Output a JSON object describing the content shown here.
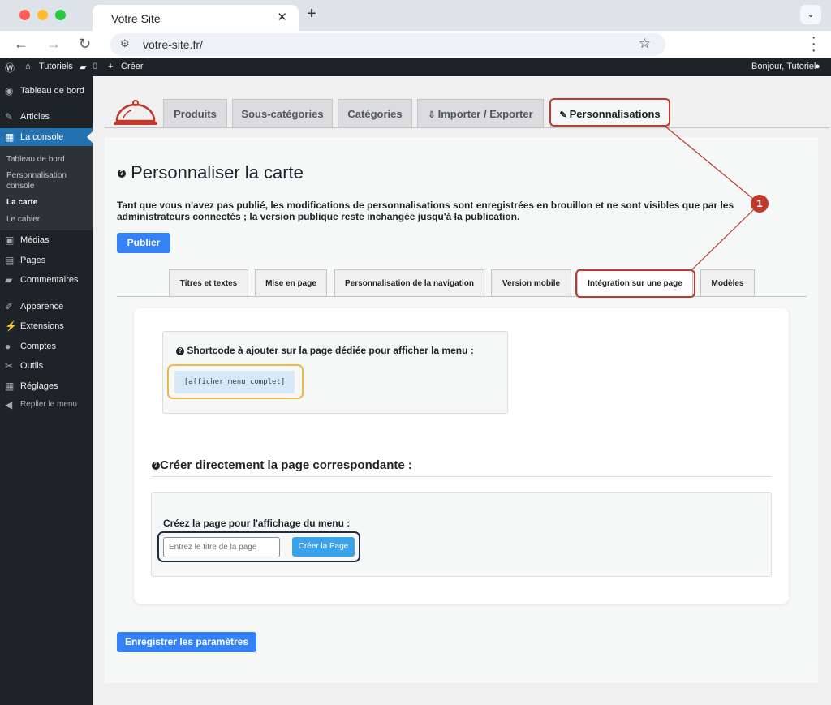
{
  "browser": {
    "tab_title": "Votre Site",
    "close": "✕",
    "new_tab": "+",
    "url": "votre-site.fr/"
  },
  "adminbar": {
    "site": "Tutoriels",
    "comments_count": "0",
    "create": "Créer",
    "greeting": "Bonjour, Tutoriel"
  },
  "sidebar": {
    "items": [
      {
        "label": "Tableau de bord"
      },
      {
        "label": "Articles"
      },
      {
        "label": "La console"
      },
      {
        "label": "Médias"
      },
      {
        "label": "Pages"
      },
      {
        "label": "Commentaires"
      },
      {
        "label": "Apparence"
      },
      {
        "label": "Extensions"
      },
      {
        "label": "Comptes"
      },
      {
        "label": "Outils"
      },
      {
        "label": "Réglages"
      },
      {
        "label": "Replier le menu"
      }
    ],
    "submenu": [
      "Tableau de bord",
      "Personnalisation console",
      "La carte",
      "Le cahier"
    ]
  },
  "top_tabs": [
    "Produits",
    "Sous-catégories",
    "Catégories",
    "Importer / Exporter",
    "Personnalisations"
  ],
  "page": {
    "title": "Personnaliser la carte",
    "notice": "Tant que vous n'avez pas publié, les modifications de personnalisations sont enregistrées en brouillon et ne sont visibles que par les administrateurs connectés ; la version publique reste inchangée jusqu'à la publication.",
    "publish_label": "Publier",
    "sub_tabs": [
      "Titres et textes",
      "Mise en page",
      "Personnalisation de la navigation",
      "Version mobile",
      "Intégration sur une page",
      "Modèles"
    ],
    "shortcode_title": "Shortcode à ajouter sur la page dédiée pour afficher la menu :",
    "shortcode": "[afficher_menu_complet]",
    "create_title": "Créer directement la page correspondante :",
    "create_label": "Créez la page pour l'affichage du menu :",
    "input_placeholder": "Entrez le titre de la page",
    "create_button": "Créer la Page",
    "save_button": "Enregistrer les paramètres",
    "annotation_number": "1"
  },
  "colors": {
    "accent": "#3582f7",
    "wp_blue": "#2271b1",
    "annotation_red": "#c0392b",
    "highlight_yellow": "#f0b849",
    "highlight_navy": "#1d2b45"
  }
}
